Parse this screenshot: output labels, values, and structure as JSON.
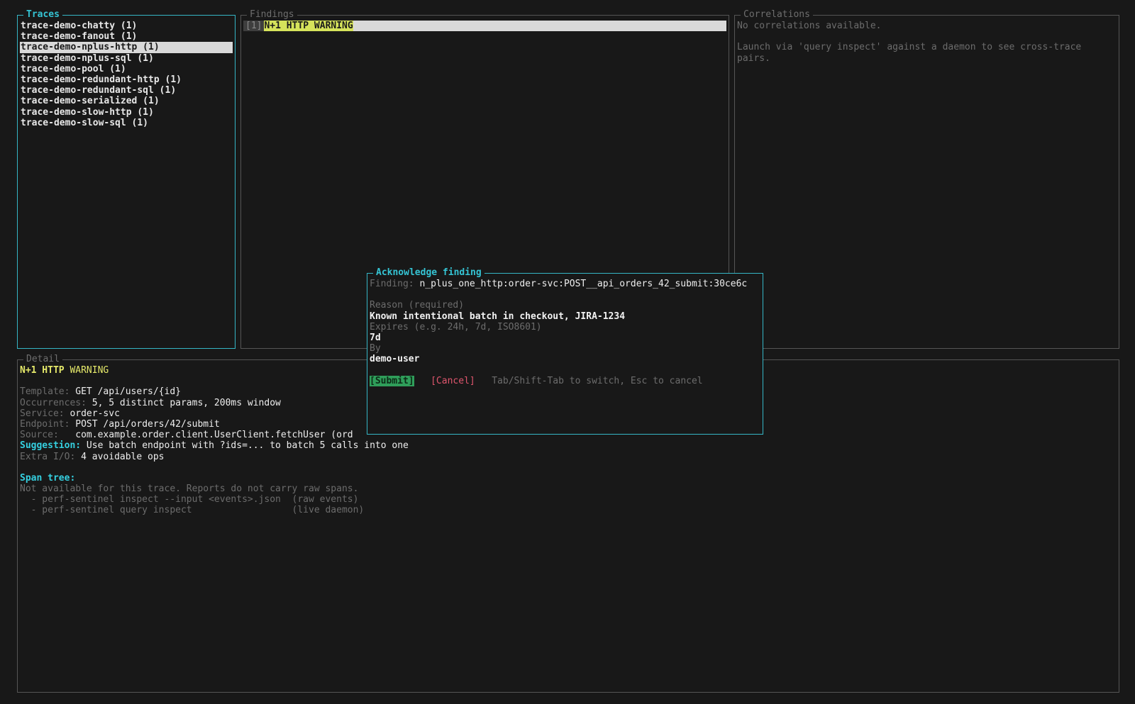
{
  "traces_panel": {
    "title": "Traces",
    "items": [
      {
        "label": "trace-demo-chatty (1)",
        "selected": false
      },
      {
        "label": "trace-demo-fanout (1)",
        "selected": false
      },
      {
        "label": "trace-demo-nplus-http (1)",
        "selected": true
      },
      {
        "label": "trace-demo-nplus-sql (1)",
        "selected": false
      },
      {
        "label": "trace-demo-pool (1)",
        "selected": false
      },
      {
        "label": "trace-demo-redundant-http (1)",
        "selected": false
      },
      {
        "label": "trace-demo-redundant-sql (1)",
        "selected": false
      },
      {
        "label": "trace-demo-serialized (1)",
        "selected": false
      },
      {
        "label": "trace-demo-slow-http (1)",
        "selected": false
      },
      {
        "label": "trace-demo-slow-sql (1)",
        "selected": false
      }
    ]
  },
  "findings_panel": {
    "title": "Findings",
    "items": [
      {
        "index": "[1]",
        "title": "N+1 HTTP WARNING"
      }
    ]
  },
  "correlations_panel": {
    "title": "Correlations",
    "line1": "No correlations available.",
    "line2": "Launch via 'query inspect' against a daemon to see cross-trace",
    "line3": "pairs."
  },
  "detail_panel": {
    "title": "Detail",
    "heading_type": "N+1 HTTP",
    "heading_severity": "WARNING",
    "fields": {
      "template_label": "Template:",
      "template_value": "GET /api/users/{id}",
      "occurrences_label": "Occurrences:",
      "occurrences_value": "5, 5 distinct params, 200ms window",
      "service_label": "Service:",
      "service_value": "order-svc",
      "endpoint_label": "Endpoint:",
      "endpoint_value": "POST /api/orders/42/submit",
      "source_label": "Source:",
      "source_value": "com.example.order.client.UserClient.fetchUser (ord",
      "suggestion_label": "Suggestion:",
      "suggestion_value": "Use batch endpoint with ?ids=... to batch 5 calls into one",
      "extra_io_label": "Extra I/O:",
      "extra_io_value": "4 avoidable ops"
    },
    "span_tree_label": "Span tree:",
    "span_tree_lines": [
      "Not available for this trace. Reports do not carry raw spans.",
      "  - perf-sentinel inspect --input <events>.json  (raw events)",
      "  - perf-sentinel query inspect                  (live daemon)"
    ]
  },
  "ack_modal": {
    "title": "Acknowledge finding",
    "finding_label": "Finding:",
    "finding_value": "n_plus_one_http:order-svc:POST__api_orders_42_submit:30ce6c",
    "reason_label": "Reason (required)",
    "reason_value": "Known intentional batch in checkout, JIRA-1234",
    "expires_label": "Expires (e.g. 24h, 7d, ISO8601)",
    "expires_value": "7d",
    "by_label": "By",
    "by_value": "demo-user",
    "submit_label": "[Submit]",
    "cancel_label": "[Cancel]",
    "hint": "Tab/Shift-Tab to switch, Esc to cancel"
  },
  "colors": {
    "background": "#181818",
    "accent_cyan": "#35b6c6",
    "highlight_yellow": "#d6e35b",
    "submit_green": "#2f9e5a",
    "cancel_red": "#e0566e"
  }
}
